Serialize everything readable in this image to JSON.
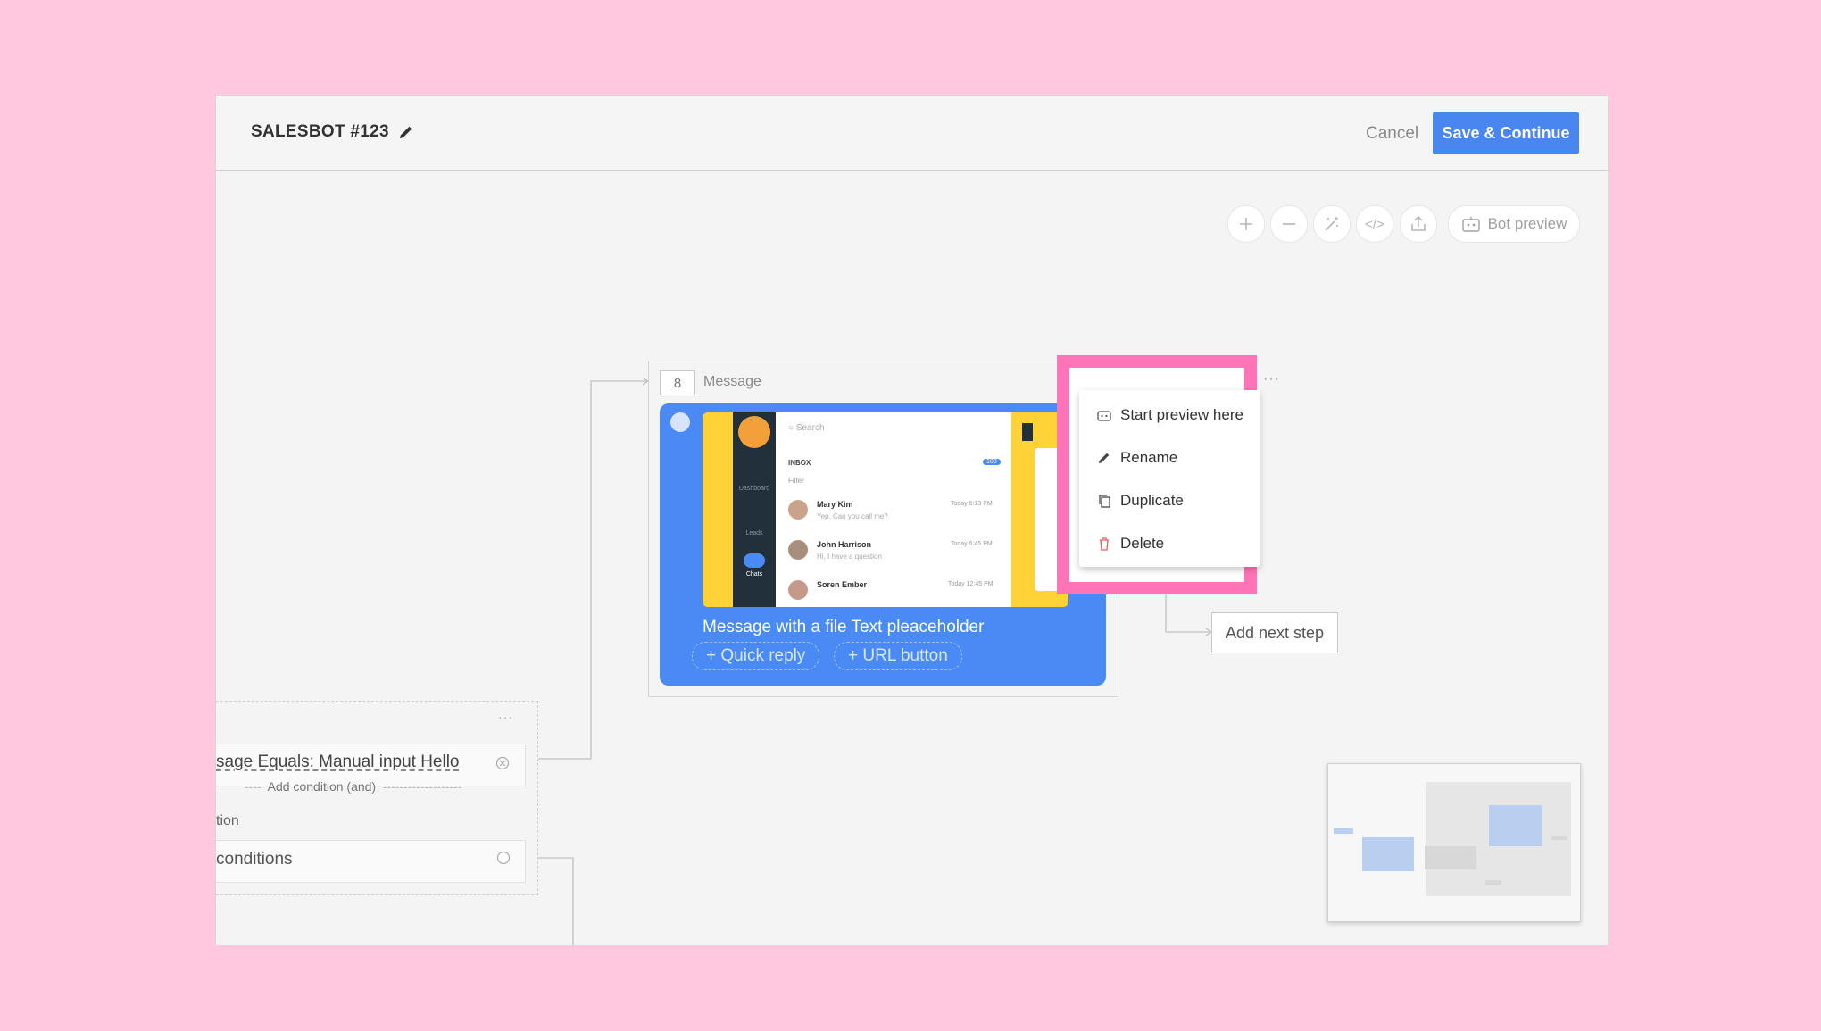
{
  "header": {
    "title": "SALESBOT #123",
    "cancel_label": "Cancel",
    "save_label": "Save & Continue"
  },
  "toolbar": {
    "bot_preview_label": "Bot preview",
    "tools": [
      "zoom-in-icon",
      "zoom-out-icon",
      "magic-wand-icon",
      "code-icon",
      "export-icon"
    ]
  },
  "message_step": {
    "number": "8",
    "type_label": "Message",
    "text": "Message with a file Text pleaceholder",
    "quick_reply_label": "+ Quick reply",
    "url_button_label": "+ URL button",
    "preview": {
      "search_placeholder": "Search",
      "inbox_label": "INBOX",
      "inbox_count": "100",
      "filter_label": "Filter",
      "sidebar": [
        "Dashboard",
        "Leads",
        "Chats"
      ],
      "chats": [
        {
          "name": "Mary Kim",
          "time": "Today 6:13 PM",
          "preview": "Yep. Can you call me?"
        },
        {
          "name": "John Harrison",
          "time": "Today 5:45 PM",
          "preview": "Hi, I have a question"
        },
        {
          "name": "Soren Ember",
          "time": "Today 12:45 PM",
          "preview": ""
        }
      ]
    }
  },
  "context_menu": {
    "items": [
      {
        "label": "Start preview here",
        "icon": "bot-icon"
      },
      {
        "label": "Rename",
        "icon": "pencil-icon"
      },
      {
        "label": "Duplicate",
        "icon": "copy-icon"
      },
      {
        "label": "Delete",
        "icon": "trash-icon"
      }
    ]
  },
  "add_next_step_label": "Add next step",
  "condition_step": {
    "condition_text": "sage Equals: Manual input  Hello",
    "add_condition_label": "Add condition (and)",
    "partial_label": "tion",
    "fallback_label": "conditions"
  },
  "colors": {
    "background": "#ffc8df",
    "accent": "#4a86f0",
    "highlight": "#ff74b7"
  }
}
